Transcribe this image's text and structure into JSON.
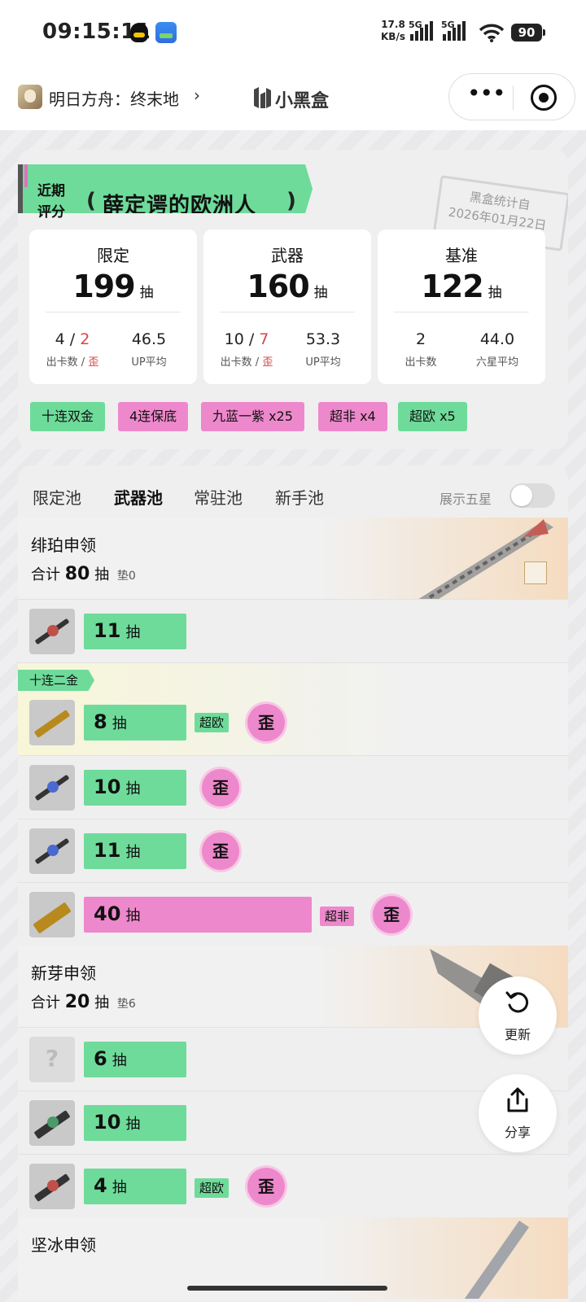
{
  "status_bar": {
    "time": "09:15:11",
    "net_speed_value": "17.8",
    "net_speed_unit": "KB/s",
    "sim1": "5G",
    "sim2": "5G",
    "battery": "90"
  },
  "header": {
    "game_name": "明日方舟：终末地",
    "chevron": "›",
    "brand": "小黑盒"
  },
  "rating": {
    "label_line1": "近期",
    "label_line2": "评分",
    "title": "薛定谔的欧洲人",
    "stamp_line1": "黑盒统计自",
    "stamp_line2": "2026年01月22日"
  },
  "stats": [
    {
      "name": "限定",
      "count": "199",
      "unit": "抽",
      "a_val": "4",
      "a_sep": " / ",
      "a_red": "2",
      "a_key": "出卡数 / ",
      "a_key_red": "歪",
      "b_val": "46.5",
      "b_key": "UP平均"
    },
    {
      "name": "武器",
      "count": "160",
      "unit": "抽",
      "a_val": "10",
      "a_sep": " / ",
      "a_red": "7",
      "a_key": "出卡数 / ",
      "a_key_red": "歪",
      "b_val": "53.3",
      "b_key": "UP平均"
    },
    {
      "name": "基准",
      "count": "122",
      "unit": "抽",
      "a_val": "2",
      "a_sep": "",
      "a_red": "",
      "a_key": "出卡数",
      "a_key_red": "",
      "b_val": "44.0",
      "b_key": "六星平均"
    }
  ],
  "tags": [
    "十连双金",
    "4连保底",
    "九蓝一紫 x25",
    "超非 x4",
    "超欧 x5"
  ],
  "tabs": [
    "限定池",
    "武器池",
    "常驻池",
    "新手池"
  ],
  "active_tab": "武器池",
  "toggle_label": "展示五星",
  "toggle_on": false,
  "pools": [
    {
      "name": "绯珀申领",
      "total_prefix": "合计",
      "total": "80",
      "total_unit": "抽",
      "pad": "垫0"
    },
    {
      "name": "新芽申领",
      "total_prefix": "合计",
      "total": "20",
      "total_unit": "抽",
      "pad": "垫6"
    },
    {
      "name": "坚冰申领"
    }
  ],
  "ten_pull_flag": "十连二金",
  "pull_unit": "抽",
  "wai_label": "歪",
  "pulls": [
    {
      "count": "11",
      "color": "green"
    },
    {
      "count": "8",
      "color": "green",
      "badge": "超欧",
      "wai": true
    },
    {
      "count": "10",
      "color": "green",
      "wai": true
    },
    {
      "count": "11",
      "color": "green",
      "wai": true
    },
    {
      "count": "40",
      "color": "pink",
      "badge": "超非",
      "wai": true
    },
    {
      "count": "6",
      "color": "green"
    },
    {
      "count": "10",
      "color": "green"
    },
    {
      "count": "4",
      "color": "green",
      "badge": "超欧",
      "wai": true
    }
  ],
  "fab": {
    "refresh": "更新",
    "share": "分享"
  },
  "icons": [
    "qq-icon",
    "app-icon",
    "signal-icon",
    "wifi-icon",
    "battery-icon",
    "more-icon",
    "close-icon",
    "refresh-icon",
    "share-icon"
  ]
}
